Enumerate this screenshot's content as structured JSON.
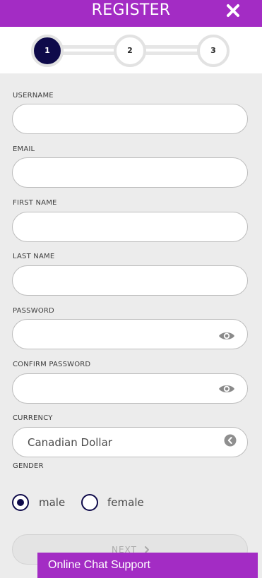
{
  "header": {
    "title": "REGISTER",
    "close_icon": "close-x-icon",
    "background": "#a32cc4"
  },
  "stepper": {
    "steps": [
      {
        "label": "1",
        "active": true
      },
      {
        "label": "2",
        "active": false
      },
      {
        "label": "3",
        "active": false
      }
    ],
    "active_color": "#0e0a4a"
  },
  "form": {
    "username": {
      "label": "USERNAME",
      "value": ""
    },
    "email": {
      "label": "EMAIL",
      "value": ""
    },
    "first_name": {
      "label": "FIRST NAME",
      "value": ""
    },
    "last_name": {
      "label": "LAST NAME",
      "value": ""
    },
    "password": {
      "label": "PASSWORD",
      "value": "",
      "toggle_icon": "eye-icon"
    },
    "confirm_password": {
      "label": "CONFIRM PASSWORD",
      "value": "",
      "toggle_icon": "eye-icon"
    },
    "currency": {
      "label": "CURRENCY",
      "selected": "Canadian Dollar",
      "icon": "chevron-left-circle-icon"
    },
    "gender": {
      "label": "GENDER",
      "options": [
        {
          "label": "male",
          "checked": true
        },
        {
          "label": "female",
          "checked": false
        }
      ]
    },
    "next_button": {
      "label": "NEXT",
      "icon": "chevron-right-icon",
      "enabled": false
    }
  },
  "chat": {
    "label": "Online Chat Support",
    "background": "#a32cc4"
  }
}
